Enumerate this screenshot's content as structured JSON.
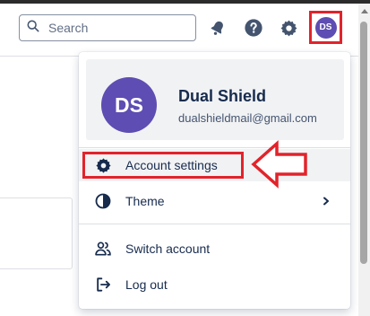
{
  "search": {
    "placeholder": "Search"
  },
  "topbar": {
    "icons": [
      "notifications-icon",
      "help-icon",
      "settings-icon"
    ],
    "avatar_initials": "DS"
  },
  "profile": {
    "initials": "DS",
    "name": "Dual Shield",
    "email": "dualshieldmail@gmail.com"
  },
  "menu": {
    "account_settings": "Account settings",
    "theme": "Theme",
    "switch_account": "Switch account",
    "log_out": "Log out"
  },
  "colors": {
    "avatar": "#5e4db2",
    "highlight": "#e2232b"
  }
}
